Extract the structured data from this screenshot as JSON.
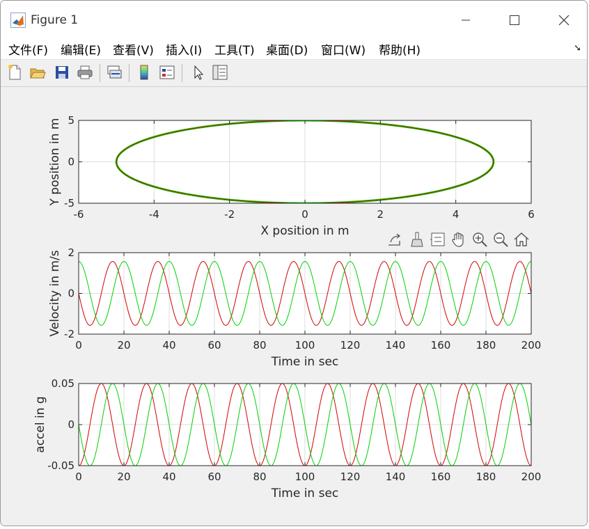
{
  "window": {
    "title": "Figure 1",
    "minimize_icon": "minimize-icon",
    "maximize_icon": "maximize-icon",
    "close_icon": "close-icon"
  },
  "menu": {
    "items": [
      "文件(F)",
      "编辑(E)",
      "查看(V)",
      "插入(I)",
      "工具(T)",
      "桌面(D)",
      "窗口(W)",
      "帮助(H)"
    ]
  },
  "toolbar": {
    "icons": [
      "new-figure-icon",
      "open-file-icon",
      "save-icon",
      "print-icon",
      "link-plot-icon",
      "insert-colorbar-icon",
      "insert-legend-icon",
      "edit-plot-icon",
      "property-inspector-icon"
    ]
  },
  "axes_toolbar": {
    "icons": [
      "export-icon",
      "brush-icon",
      "datatip-icon",
      "pan-icon",
      "zoom-in-icon",
      "zoom-out-icon",
      "home-icon"
    ]
  },
  "colors": {
    "red_series": "#d10000",
    "green_series": "#00d000",
    "grid": "#dcdcdc",
    "axes_bg": "#ffffff"
  },
  "chart_data": [
    {
      "type": "line",
      "xlabel": "X position in m",
      "ylabel": "Y position in m",
      "xlim": [
        -6,
        6
      ],
      "ylim": [
        -5,
        5
      ],
      "xticks": [
        "-6",
        "-4",
        "-2",
        "0",
        "2",
        "4",
        "6"
      ],
      "yticks": [
        "5",
        "0",
        "-5"
      ],
      "grid": true,
      "series": [
        {
          "color": "#00d000",
          "shape": "ellipse",
          "x_radius": 5,
          "y_radius": 5,
          "width": 3
        },
        {
          "color": "#d10000",
          "shape": "ellipse",
          "x_radius": 5,
          "y_radius": 5,
          "width": 1
        }
      ]
    },
    {
      "type": "line",
      "xlabel": "Time in sec",
      "ylabel": "Velocity in m/s",
      "xlim": [
        0,
        200
      ],
      "ylim": [
        -2,
        2
      ],
      "xticks": [
        "0",
        "20",
        "40",
        "60",
        "80",
        "100",
        "120",
        "140",
        "160",
        "180",
        "200"
      ],
      "yticks": [
        "2",
        "0",
        "-2"
      ],
      "grid": true,
      "series": [
        {
          "color": "#d10000",
          "function": "-A*sin(2*pi*t/T)",
          "amplitude": 1.57,
          "period": 20
        },
        {
          "color": "#00d000",
          "function": "A*cos(2*pi*t/T)",
          "amplitude": 1.57,
          "period": 20
        }
      ]
    },
    {
      "type": "line",
      "xlabel": "Time in sec",
      "ylabel": "accel in g",
      "xlim": [
        0,
        200
      ],
      "ylim": [
        -0.05,
        0.05
      ],
      "xticks": [
        "0",
        "20",
        "40",
        "60",
        "80",
        "100",
        "120",
        "140",
        "160",
        "180",
        "200"
      ],
      "yticks": [
        "0.05",
        "0",
        "-0.05"
      ],
      "grid": true,
      "series": [
        {
          "color": "#d10000",
          "function": "-A*cos(2*pi*t/T)",
          "amplitude": 0.05,
          "period": 20
        },
        {
          "color": "#00d000",
          "function": "-A*sin(2*pi*t/T)",
          "amplitude": 0.05,
          "period": 20
        }
      ]
    }
  ]
}
